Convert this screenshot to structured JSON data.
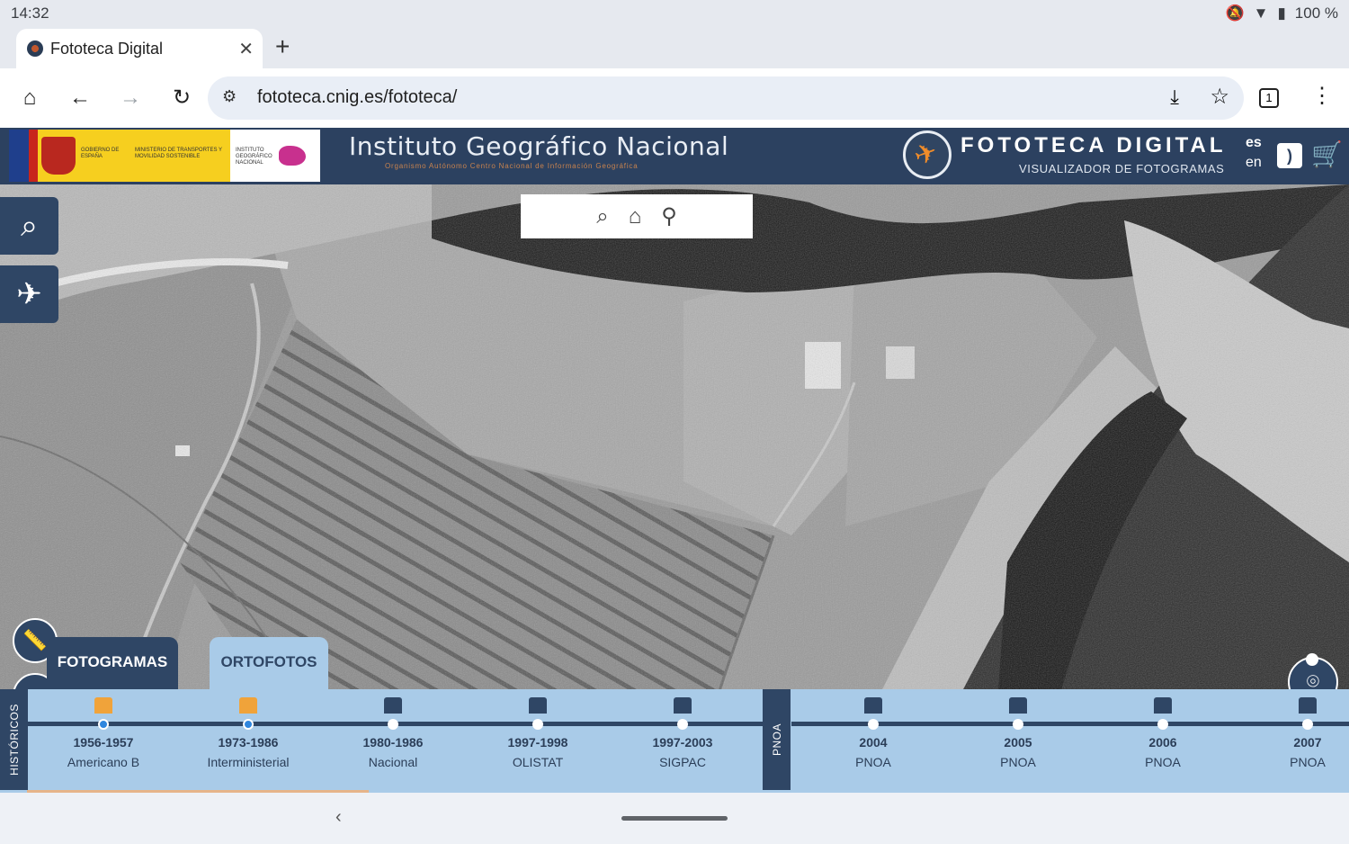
{
  "status_bar": {
    "time": "14:32",
    "battery": "100 %"
  },
  "browser": {
    "tab_title": "Fototeca Digital",
    "url": "fototeca.cnig.es/fototeca/",
    "tab_count": "1"
  },
  "header": {
    "gov_lines": [
      "GOBIERNO DE ESPAÑA",
      "MINISTERIO DE TRANSPORTES Y MOVILIDAD SOSTENIBLE"
    ],
    "ign_small": "INSTITUTO GEOGRÁFICO NACIONAL",
    "ign_title": "Instituto Geográfico Nacional",
    "ign_subtitle": "Organismo Autónomo Centro Nacional de Información Geográfica",
    "site_title": "FOTOTECA DIGITAL",
    "site_subtitle": "VISUALIZADOR DE FOTOGRAMAS",
    "lang_es": "es",
    "lang_en": "en"
  },
  "map_tabs": {
    "fotogramas": "FOTOGRAMAS",
    "ortofotos": "ORTOFOTOS"
  },
  "timeline": {
    "left_label": "HISTÓRICOS",
    "mid_label": "PNOA",
    "items": [
      {
        "year": "1956-1957",
        "name": "Americano B",
        "active": true
      },
      {
        "year": "1973-1986",
        "name": "Interministerial",
        "active": true
      },
      {
        "year": "1980-1986",
        "name": "Nacional",
        "active": false
      },
      {
        "year": "1997-1998",
        "name": "OLISTAT",
        "active": false
      },
      {
        "year": "1997-2003",
        "name": "SIGPAC",
        "active": false
      },
      {
        "year": "2004",
        "name": "PNOA",
        "active": false
      },
      {
        "year": "2005",
        "name": "PNOA",
        "active": false
      },
      {
        "year": "2006",
        "name": "PNOA",
        "active": false
      },
      {
        "year": "2007",
        "name": "PNOA",
        "active": false
      }
    ]
  },
  "colors": {
    "navy": "#2f4665",
    "light_blue": "#a9cbe8",
    "orange": "#f0a33a",
    "active_dot": "#2e86de"
  }
}
